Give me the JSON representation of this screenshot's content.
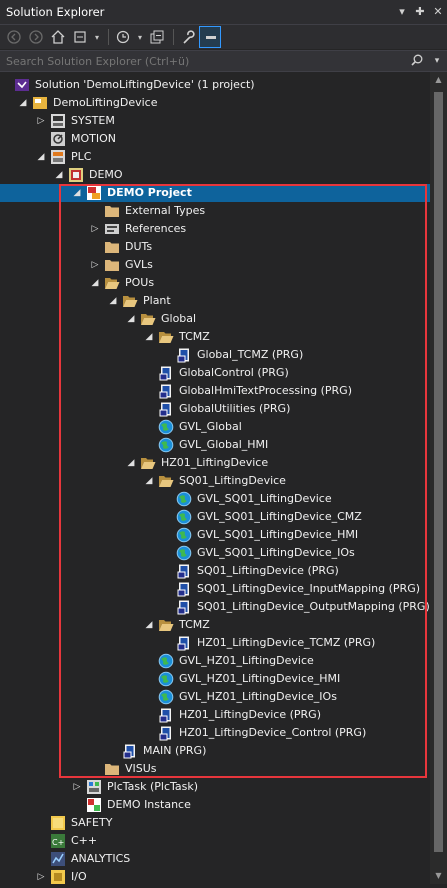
{
  "title": "Solution Explorer",
  "title_buttons": [
    "▾",
    "✚",
    "✕"
  ],
  "search": {
    "placeholder": "Search Solution Explorer (Ctrl+ü)"
  },
  "toolbar": {
    "icons": [
      "back-icon",
      "forward-icon",
      "home-icon",
      "sync-icon",
      "history-icon",
      "collapse-icon",
      "properties-icon",
      "preview-icon"
    ]
  },
  "colors": {
    "selection": "#0e639c",
    "highlight_box": "#e8363c",
    "folder": "#dcb67a"
  },
  "tree": [
    {
      "label": "Solution 'DemoLiftingDevice' (1 project)",
      "level": 0,
      "icon": "solution",
      "expander": ""
    },
    {
      "label": "DemoLiftingDevice",
      "level": 1,
      "icon": "project",
      "expander": "open"
    },
    {
      "label": "SYSTEM",
      "level": 2,
      "icon": "system",
      "expander": "closed"
    },
    {
      "label": "MOTION",
      "level": 2,
      "icon": "motion",
      "expander": ""
    },
    {
      "label": "PLC",
      "level": 2,
      "icon": "plc",
      "expander": "open"
    },
    {
      "label": "DEMO",
      "level": 3,
      "icon": "plcproject",
      "expander": "open"
    },
    {
      "label": "DEMO Project",
      "level": 4,
      "icon": "plcsub",
      "expander": "open",
      "selected": true
    },
    {
      "label": "External Types",
      "level": 5,
      "icon": "folder",
      "expander": ""
    },
    {
      "label": "References",
      "level": 5,
      "icon": "references",
      "expander": "closed"
    },
    {
      "label": "DUTs",
      "level": 5,
      "icon": "folder",
      "expander": ""
    },
    {
      "label": "GVLs",
      "level": 5,
      "icon": "folder",
      "expander": "closed"
    },
    {
      "label": "POUs",
      "level": 5,
      "icon": "folderopen",
      "expander": "open"
    },
    {
      "label": "Plant",
      "level": 6,
      "icon": "folderopen",
      "expander": "open"
    },
    {
      "label": "Global",
      "level": 7,
      "icon": "folderopen",
      "expander": "open"
    },
    {
      "label": "TCMZ",
      "level": 8,
      "icon": "folderopen",
      "expander": "open"
    },
    {
      "label": "Global_TCMZ (PRG)",
      "level": 9,
      "icon": "prg",
      "expander": ""
    },
    {
      "label": "GlobalControl (PRG)",
      "level": 8,
      "icon": "prg",
      "expander": ""
    },
    {
      "label": "GlobalHmiTextProcessing (PRG)",
      "level": 8,
      "icon": "prg",
      "expander": ""
    },
    {
      "label": "GlobalUtilities (PRG)",
      "level": 8,
      "icon": "prg",
      "expander": ""
    },
    {
      "label": "GVL_Global",
      "level": 8,
      "icon": "gvl",
      "expander": ""
    },
    {
      "label": "GVL_Global_HMI",
      "level": 8,
      "icon": "gvl",
      "expander": ""
    },
    {
      "label": "HZ01_LiftingDevice",
      "level": 7,
      "icon": "folderopen",
      "expander": "open"
    },
    {
      "label": "SQ01_LiftingDevice",
      "level": 8,
      "icon": "folderopen",
      "expander": "open"
    },
    {
      "label": "GVL_SQ01_LiftingDevice",
      "level": 9,
      "icon": "gvl",
      "expander": ""
    },
    {
      "label": "GVL_SQ01_LiftingDevice_CMZ",
      "level": 9,
      "icon": "gvl",
      "expander": ""
    },
    {
      "label": "GVL_SQ01_LiftingDevice_HMI",
      "level": 9,
      "icon": "gvl",
      "expander": ""
    },
    {
      "label": "GVL_SQ01_LiftingDevice_IOs",
      "level": 9,
      "icon": "gvl",
      "expander": ""
    },
    {
      "label": "SQ01_LiftingDevice (PRG)",
      "level": 9,
      "icon": "prg",
      "expander": ""
    },
    {
      "label": "SQ01_LiftingDevice_InputMapping (PRG)",
      "level": 9,
      "icon": "prg",
      "expander": ""
    },
    {
      "label": "SQ01_LiftingDevice_OutputMapping (PRG)",
      "level": 9,
      "icon": "prg",
      "expander": ""
    },
    {
      "label": "TCMZ",
      "level": 8,
      "icon": "folderopen",
      "expander": "open"
    },
    {
      "label": "HZ01_LiftingDevice_TCMZ (PRG)",
      "level": 9,
      "icon": "prg",
      "expander": ""
    },
    {
      "label": "GVL_HZ01_LiftingDevice",
      "level": 8,
      "icon": "gvl",
      "expander": ""
    },
    {
      "label": "GVL_HZ01_LiftingDevice_HMI",
      "level": 8,
      "icon": "gvl",
      "expander": ""
    },
    {
      "label": "GVL_HZ01_LiftingDevice_IOs",
      "level": 8,
      "icon": "gvl",
      "expander": ""
    },
    {
      "label": "HZ01_LiftingDevice (PRG)",
      "level": 8,
      "icon": "prg",
      "expander": ""
    },
    {
      "label": "HZ01_LiftingDevice_Control (PRG)",
      "level": 8,
      "icon": "prg",
      "expander": ""
    },
    {
      "label": "MAIN (PRG)",
      "level": 6,
      "icon": "prg",
      "expander": ""
    },
    {
      "label": "VISUs",
      "level": 5,
      "icon": "folder",
      "expander": ""
    },
    {
      "label": "PlcTask (PlcTask)",
      "level": 4,
      "icon": "task",
      "expander": "closed"
    },
    {
      "label": "DEMO Instance",
      "level": 4,
      "icon": "instance",
      "expander": ""
    },
    {
      "label": "SAFETY",
      "level": 2,
      "icon": "safety",
      "expander": ""
    },
    {
      "label": "C++",
      "level": 2,
      "icon": "cpp",
      "expander": ""
    },
    {
      "label": "ANALYTICS",
      "level": 2,
      "icon": "analytics",
      "expander": ""
    },
    {
      "label": "I/O",
      "level": 2,
      "icon": "io",
      "expander": "closed"
    }
  ]
}
